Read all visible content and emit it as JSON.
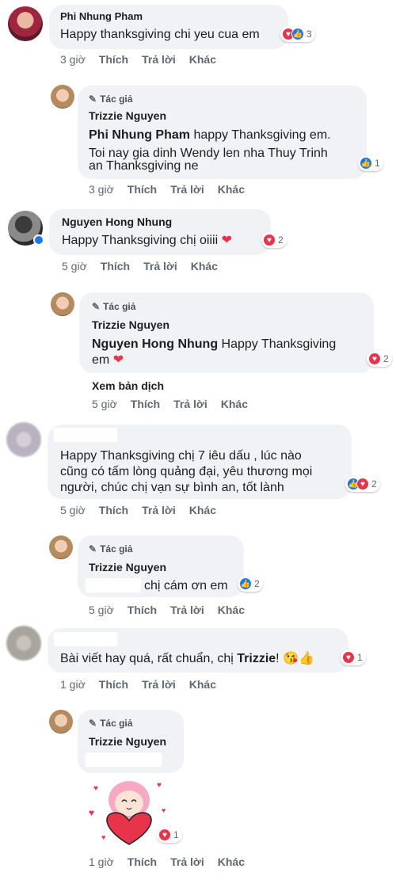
{
  "comments": [
    {
      "author": "Phi Nhung Pham",
      "text": "Happy thanksgiving chi yeu cua em",
      "reaction_count": "3",
      "time": "3 giờ",
      "actions": [
        "Thích",
        "Trả lời",
        "Khác"
      ],
      "reply": {
        "badge": "Tác giả",
        "author": "Trizzie Nguyen",
        "mention": "Phi Nhung Pham",
        "line1": " happy Thanksgiving em.",
        "line2": "Toi nay gia dinh Wendy len nha Thuy Trinh",
        "line3": "an Thanksgiving ne",
        "reaction_count": "1",
        "time": "3 giờ",
        "actions": [
          "Thích",
          "Trả lời",
          "Khác"
        ]
      }
    },
    {
      "author": "Nguyen Hong Nhung",
      "text": "Happy Thanksgiving chị oiiii",
      "reaction_count": "2",
      "time": "5 giờ",
      "actions": [
        "Thích",
        "Trả lời",
        "Khác"
      ],
      "reply": {
        "badge": "Tác giả",
        "author": "Trizzie Nguyen",
        "mention": "Nguyen Hong Nhung",
        "line1": " Happy Thanksgiving",
        "line2": "em",
        "reaction_count": "2",
        "see_translation": "Xem bản dịch",
        "time": "5 giờ",
        "actions": [
          "Thích",
          "Trả lời",
          "Khác"
        ]
      }
    },
    {
      "text1": "Happy Thanksgiving chị 7 iêu dấu , lúc nào",
      "text2": "cũng có tấm lòng quảng đại, yêu thương mọi",
      "text3": "người, chúc chị vạn sự bình an, tốt lành",
      "reaction_count": "2",
      "time": "5 giờ",
      "actions": [
        "Thích",
        "Trả lời",
        "Khác"
      ],
      "reply": {
        "badge": "Tác giả",
        "author": "Trizzie Nguyen",
        "text": "chị cám ơn em",
        "reaction_count": "2",
        "time": "5 giờ",
        "actions": [
          "Thích",
          "Trả lời",
          "Khác"
        ]
      }
    },
    {
      "text": "Bài viết hay quá, rất chuẩn, chị ",
      "mention": "Trizzie",
      "text_end": "!",
      "reaction_count": "1",
      "time": "1 giờ",
      "actions": [
        "Thích",
        "Trả lời",
        "Khác"
      ],
      "reply": {
        "badge": "Tác giả",
        "author": "Trizzie Nguyen",
        "reaction_count": "1",
        "time": "1 giờ",
        "actions": [
          "Thích",
          "Trả lời",
          "Khác"
        ]
      }
    }
  ],
  "colors": {
    "bubble": "#f0f2f5",
    "heart": "#e8344a",
    "like": "#1877f2",
    "meta": "#606770"
  }
}
